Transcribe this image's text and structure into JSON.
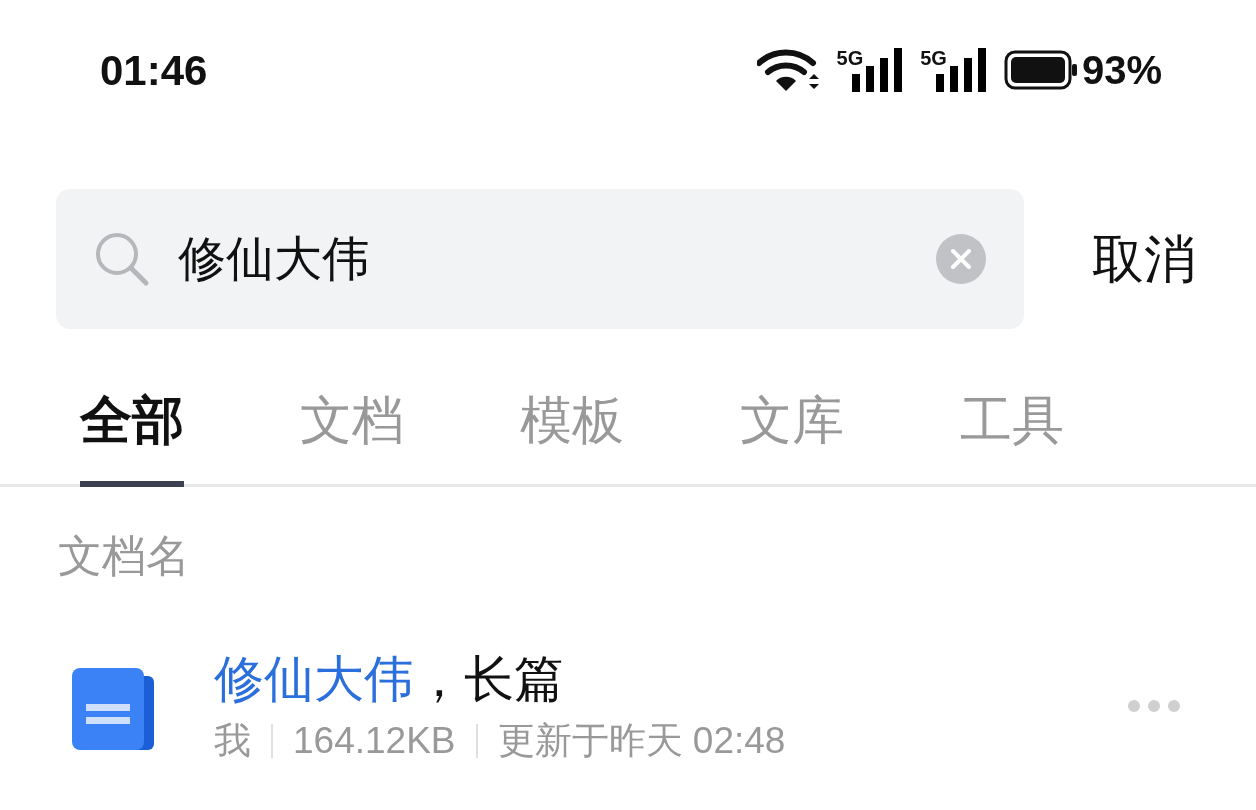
{
  "status_bar": {
    "time": "01:46",
    "signals": [
      "5G",
      "5G"
    ],
    "battery": "93%"
  },
  "search": {
    "value": "修仙大伟",
    "cancel": "取消"
  },
  "tabs": [
    {
      "label": "全部",
      "selected": true
    },
    {
      "label": "文档",
      "selected": false
    },
    {
      "label": "模板",
      "selected": false
    },
    {
      "label": "文库",
      "selected": false
    },
    {
      "label": "工具",
      "selected": false
    }
  ],
  "section": {
    "title": "文档名"
  },
  "results": [
    {
      "title_parts": [
        {
          "text": "修仙大伟",
          "highlight": true
        },
        {
          "text": "，长篇",
          "highlight": false
        }
      ],
      "meta": [
        "我",
        "164.12KB",
        "更新于昨天 02:48"
      ]
    }
  ]
}
